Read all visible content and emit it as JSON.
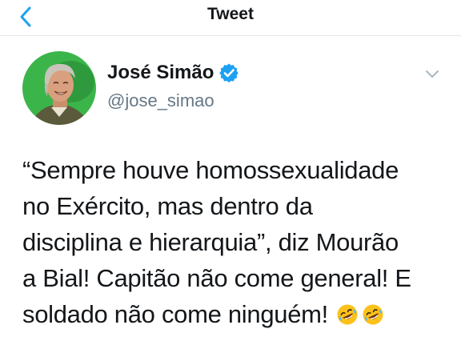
{
  "header": {
    "title": "Tweet",
    "back_icon": "chevron-left-icon",
    "accent_color": "#1da1f2"
  },
  "tweet": {
    "author": {
      "display_name": "José Simão",
      "handle": "@jose_simao",
      "verified": true,
      "avatar_icon": "avatar-photo",
      "avatar_bg": "#3bb54a"
    },
    "more_icon": "chevron-down-icon",
    "text_lines": [
      "“Sempre houve homossexualidade",
      "no Exército, mas dentro da",
      "disciplina e hierarquia”, diz Mourão",
      "a Bial! Capitão não come general! E",
      "soldado não come ninguém!"
    ],
    "emojis": [
      "rolling-on-floor-laughing-emoji",
      "rolling-on-floor-laughing-emoji"
    ]
  }
}
